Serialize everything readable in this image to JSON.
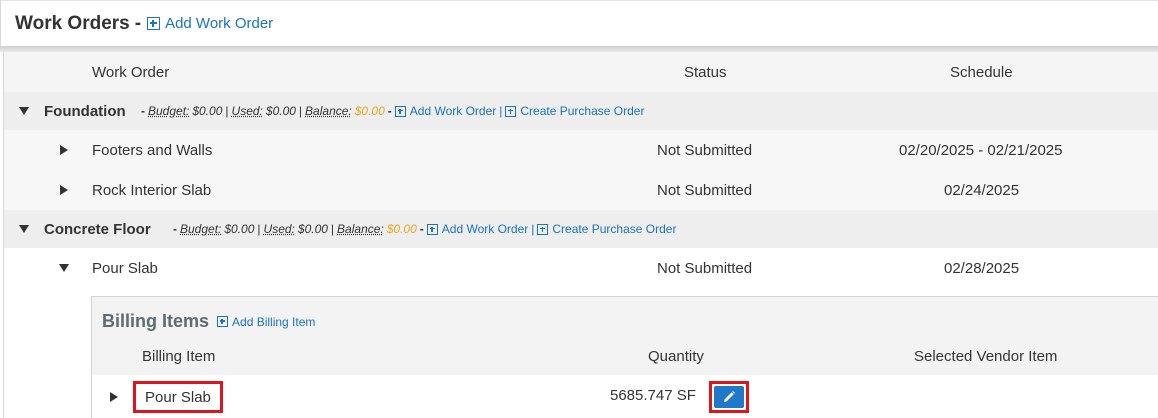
{
  "header": {
    "title": "Work Orders",
    "dash": "-",
    "add_label": "Add Work Order"
  },
  "columns": {
    "work_order": "Work Order",
    "status": "Status",
    "schedule": "Schedule"
  },
  "groups": [
    {
      "name": "Foundation",
      "dash": "-",
      "budget_label": "Budget:",
      "budget": "$0.00",
      "used_label": "Used:",
      "used": "$0.00",
      "balance_label": "Balance:",
      "balance": "$0.00",
      "add_work_order": "Add Work Order",
      "sep": "|",
      "create_po": "Create Purchase Order",
      "items": [
        {
          "name": "Footers and Walls",
          "status": "Not Submitted",
          "schedule": "02/20/2025 - 02/21/2025"
        },
        {
          "name": "Rock Interior Slab",
          "status": "Not Submitted",
          "schedule": "02/24/2025"
        }
      ]
    },
    {
      "name": "Concrete Floor",
      "dash": "-",
      "budget_label": "Budget:",
      "budget": "$0.00",
      "used_label": "Used:",
      "used": "$0.00",
      "balance_label": "Balance:",
      "balance": "$0.00",
      "add_work_order": "Add Work Order",
      "sep": "|",
      "create_po": "Create Purchase Order",
      "items": [
        {
          "name": "Pour Slab",
          "status": "Not Submitted",
          "schedule": "02/28/2025"
        }
      ]
    }
  ],
  "billing": {
    "title": "Billing Items",
    "add_label": "Add Billing Item",
    "columns": {
      "item": "Billing Item",
      "quantity": "Quantity",
      "vendor": "Selected Vendor Item"
    },
    "rows": [
      {
        "name": "Pour Slab",
        "quantity": "5685.747 SF"
      }
    ]
  },
  "colors": {
    "link": "#1a73c6",
    "balance": "#f0a51e",
    "highlight": "#e0141e",
    "edit_button": "#1f78c8"
  },
  "icons": {
    "add": "plus-square-icon",
    "expand": "caret-right-icon",
    "collapse": "caret-down-icon",
    "edit": "pencil-icon"
  }
}
